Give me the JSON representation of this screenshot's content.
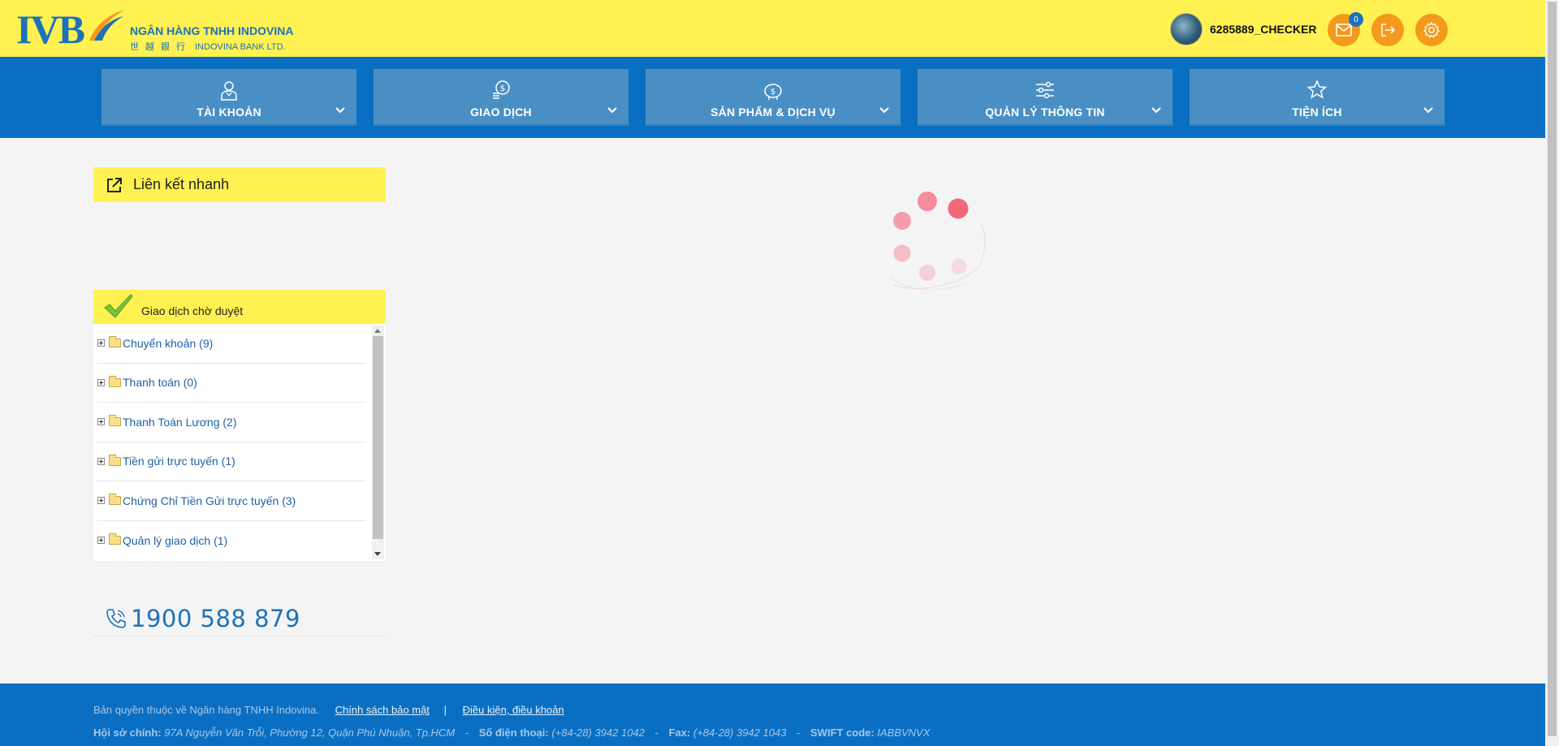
{
  "brand": {
    "logo_text": "IVB",
    "name_vi": "NGÂN HÀNG TNHH INDOVINA",
    "name_cn": "世越銀行",
    "name_en": "INDOVINA BANK LTD.",
    "primary_color": "#1d72b8",
    "yellow": "#fff152",
    "orange": "#f39a1d"
  },
  "user": {
    "username": "6285889_CHECKER",
    "mail_count": "0"
  },
  "nav": {
    "items": [
      {
        "label": "TÀI KHOẢN",
        "icon": "user-account-icon"
      },
      {
        "label": "GIAO DỊCH",
        "icon": "coins-icon"
      },
      {
        "label": "SẢN PHẨM & DỊCH VỤ",
        "icon": "piggy-bank-icon"
      },
      {
        "label": "QUẢN LÝ THÔNG TIN",
        "icon": "sliders-icon"
      },
      {
        "label": "TIỆN ÍCH",
        "icon": "star-icon"
      }
    ]
  },
  "quick_links": {
    "title": "Liên kết nhanh"
  },
  "pending": {
    "title": "Giao dịch chờ duyệt",
    "items": [
      {
        "label": "Chuyển khoản (9)"
      },
      {
        "label": "Thanh toán (0)"
      },
      {
        "label": "Thanh Toán Lương (2)"
      },
      {
        "label": "Tiền gửi trực tuyến (1)"
      },
      {
        "label": "Chứng Chỉ Tiền Gửi trực tuyến (3)"
      },
      {
        "label": "Quản lý giao dịch (1)"
      }
    ]
  },
  "hotline": {
    "number": "1900 588 879"
  },
  "footer": {
    "copyright": "Bản quyền thuộc về Ngân hàng TNHH Indovina.",
    "privacy_link": "Chính sách bảo mật",
    "separator": "|",
    "terms_link": "Điều kiện, điều khoản",
    "hq_label": "Hội sở chính:",
    "hq_value": "97A Nguyễn Văn Trỗi, Phường 12, Quận Phú Nhuận, Tp.HCM",
    "phone_label": "Số điện thoại:",
    "phone_value": "(+84-28) 3942 1042",
    "fax_label": "Fax:",
    "fax_value": "(+84-28) 3942 1043",
    "swift_label": "SWIFT code:",
    "swift_value": "IABBVNVX"
  }
}
